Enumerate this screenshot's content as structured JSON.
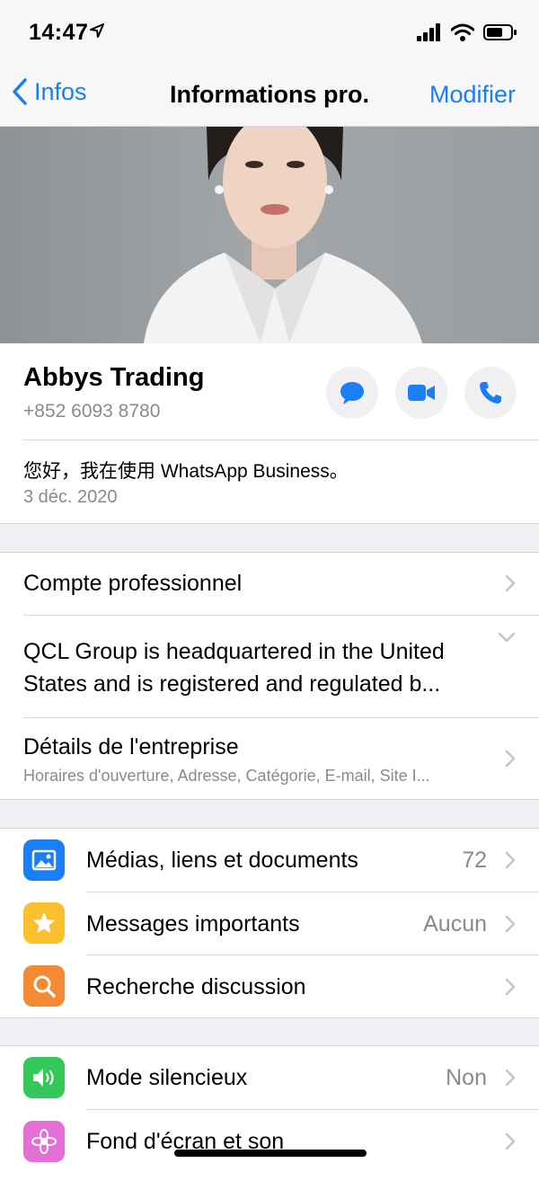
{
  "status_bar": {
    "time": "14:47"
  },
  "nav": {
    "back_label": "Infos",
    "title": "Informations pro.",
    "edit_label": "Modifier"
  },
  "contact": {
    "name": "Abbys Trading",
    "phone": "+852 6093 8780",
    "status": "您好，我在使用 WhatsApp Business。",
    "status_date": "3 déc. 2020"
  },
  "business": {
    "account_label": "Compte professionnel",
    "description_line1": "QCL Group is headquartered in the United",
    "description_line2": "States and is registered and regulated b...",
    "details_label": "Détails de l'entreprise",
    "details_sub": "Horaires d'ouverture, Adresse, Catégorie, E-mail, Site I..."
  },
  "media_group": [
    {
      "label": "Médias, liens et documents",
      "value": "72",
      "icon": "photo-icon",
      "color": "#1a7ef5"
    },
    {
      "label": "Messages importants",
      "value": "Aucun",
      "icon": "star-icon",
      "color": "#fbc02d"
    },
    {
      "label": "Recherche discussion",
      "value": "",
      "icon": "search-icon",
      "color": "#f58a34"
    }
  ],
  "settings_group": [
    {
      "label": "Mode silencieux",
      "value": "Non",
      "icon": "speaker-icon",
      "color": "#34c759"
    },
    {
      "label": "Fond d'écran et son",
      "value": "",
      "icon": "flower-icon",
      "color": "#e46fd6"
    }
  ],
  "colors": {
    "accent": "#1a7ef5",
    "background": "#efeff4",
    "secondary_text": "#8a8a8e"
  }
}
